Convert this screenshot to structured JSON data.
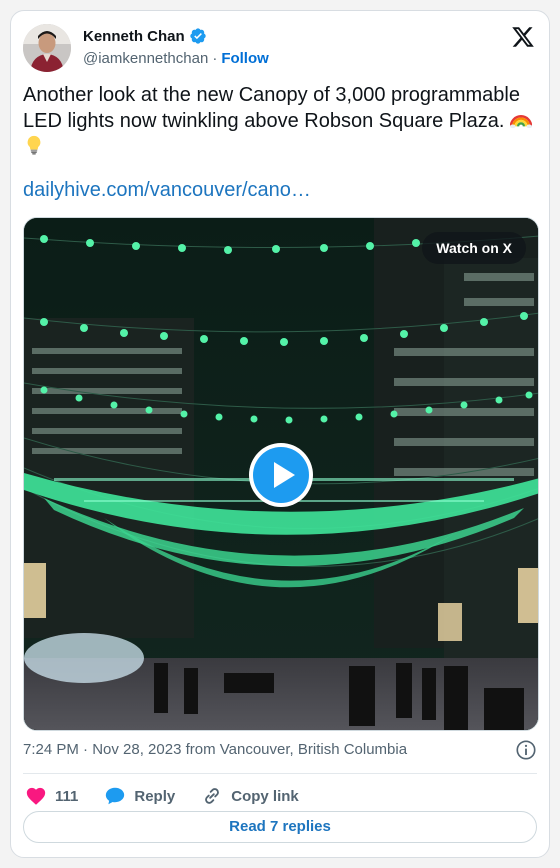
{
  "author": {
    "name": "Kenneth Chan",
    "handle": "@iamkennethchan",
    "separator": "·",
    "follow_label": "Follow",
    "verified_icon": "verified-badge-icon",
    "avatar": "avatar"
  },
  "tweet": {
    "text": "Another look at the new Canopy of 3,000 programmable LED lights now twinkling above Robson Square Plaza.",
    "emojis": [
      "rainbow-emoji",
      "light-bulb-emoji"
    ],
    "link": "dailyhive.com/vancouver/cano…"
  },
  "media": {
    "watch_label": "Watch on X",
    "play_icon": "play-icon"
  },
  "meta": {
    "timestamp": "7:24 PM · Nov 28, 2023 from Vancouver, British Columbia"
  },
  "actions": {
    "likes_count": "111",
    "reply_label": "Reply",
    "copy_link_label": "Copy link"
  },
  "footer": {
    "read_replies_label": "Read 7 replies"
  },
  "colors": {
    "accent": "#1d9bf0",
    "link": "#1d75bf",
    "follow": "#006fd6",
    "like": "#f91880",
    "muted": "#536471"
  }
}
